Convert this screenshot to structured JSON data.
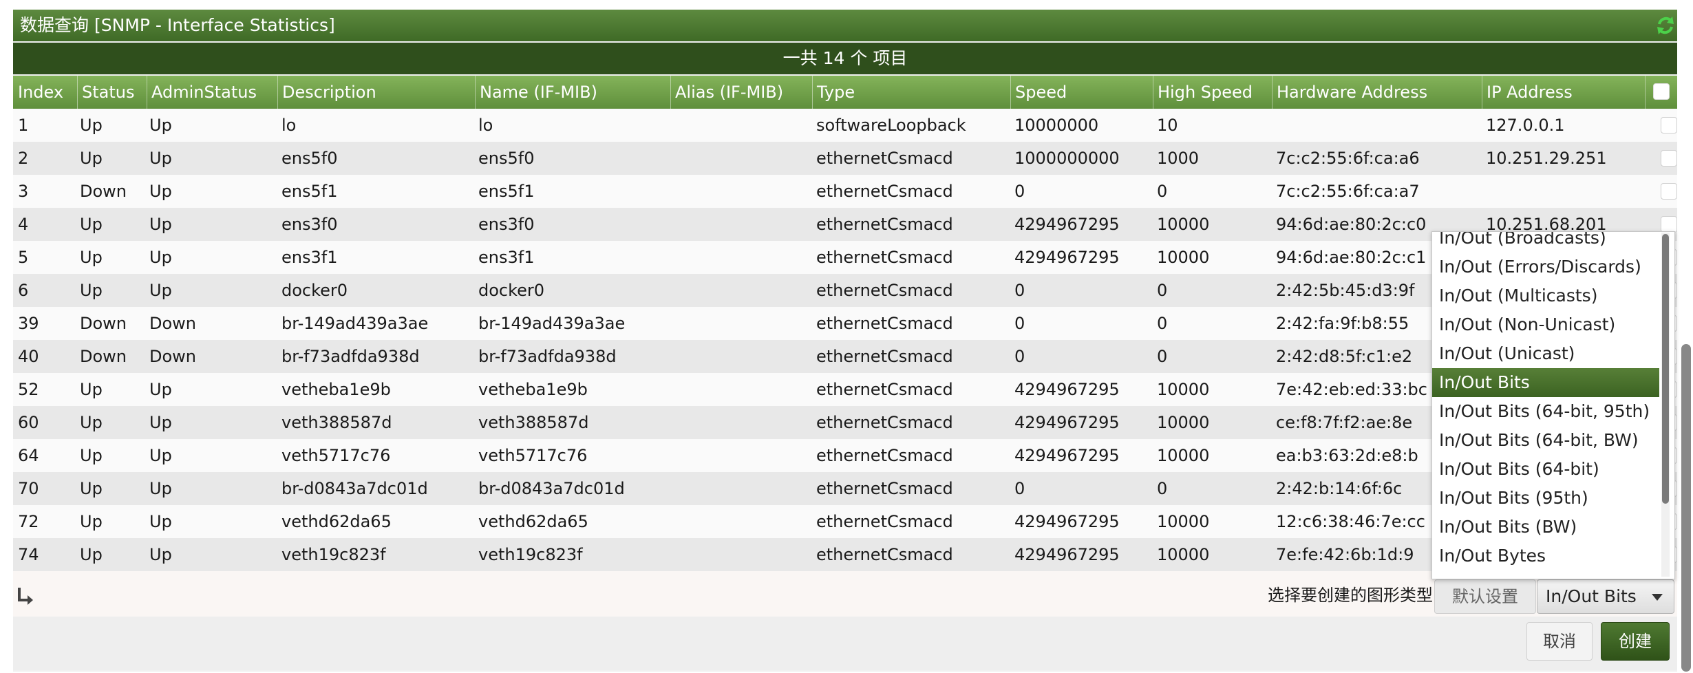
{
  "title": "数据查询 [SNMP - Interface Statistics]",
  "count_text": "一共 14 个 项目",
  "columns": [
    "Index",
    "Status",
    "AdminStatus",
    "Description",
    "Name (IF-MIB)",
    "Alias (IF-MIB)",
    "Type",
    "Speed",
    "High Speed",
    "Hardware Address",
    "IP Address"
  ],
  "rows": [
    [
      "1",
      "Up",
      "Up",
      "lo",
      "lo",
      "",
      "softwareLoopback",
      "10000000",
      "10",
      "",
      "127.0.0.1"
    ],
    [
      "2",
      "Up",
      "Up",
      "ens5f0",
      "ens5f0",
      "",
      "ethernetCsmacd",
      "1000000000",
      "1000",
      "7c:c2:55:6f:ca:a6",
      "10.251.29.251"
    ],
    [
      "3",
      "Down",
      "Up",
      "ens5f1",
      "ens5f1",
      "",
      "ethernetCsmacd",
      "0",
      "0",
      "7c:c2:55:6f:ca:a7",
      ""
    ],
    [
      "4",
      "Up",
      "Up",
      "ens3f0",
      "ens3f0",
      "",
      "ethernetCsmacd",
      "4294967295",
      "10000",
      "94:6d:ae:80:2c:c0",
      "10.251.68.201"
    ],
    [
      "5",
      "Up",
      "Up",
      "ens3f1",
      "ens3f1",
      "",
      "ethernetCsmacd",
      "4294967295",
      "10000",
      "94:6d:ae:80:2c:c1",
      ""
    ],
    [
      "6",
      "Up",
      "Up",
      "docker0",
      "docker0",
      "",
      "ethernetCsmacd",
      "0",
      "0",
      "2:42:5b:45:d3:9f",
      ""
    ],
    [
      "39",
      "Down",
      "Down",
      "br-149ad439a3ae",
      "br-149ad439a3ae",
      "",
      "ethernetCsmacd",
      "0",
      "0",
      "2:42:fa:9f:b8:55",
      ""
    ],
    [
      "40",
      "Down",
      "Down",
      "br-f73adfda938d",
      "br-f73adfda938d",
      "",
      "ethernetCsmacd",
      "0",
      "0",
      "2:42:d8:5f:c1:e2",
      ""
    ],
    [
      "52",
      "Up",
      "Up",
      "vetheba1e9b",
      "vetheba1e9b",
      "",
      "ethernetCsmacd",
      "4294967295",
      "10000",
      "7e:42:eb:ed:33:bc",
      ""
    ],
    [
      "60",
      "Up",
      "Up",
      "veth388587d",
      "veth388587d",
      "",
      "ethernetCsmacd",
      "4294967295",
      "10000",
      "ce:f8:7f:f2:ae:8e",
      ""
    ],
    [
      "64",
      "Up",
      "Up",
      "veth5717c76",
      "veth5717c76",
      "",
      "ethernetCsmacd",
      "4294967295",
      "10000",
      "ea:b3:63:2d:e8:b",
      ""
    ],
    [
      "70",
      "Up",
      "Up",
      "br-d0843a7dc01d",
      "br-d0843a7dc01d",
      "",
      "ethernetCsmacd",
      "0",
      "0",
      "2:42:b:14:6f:6c",
      ""
    ],
    [
      "72",
      "Up",
      "Up",
      "vethd62da65",
      "vethd62da65",
      "",
      "ethernetCsmacd",
      "4294967295",
      "10000",
      "12:c6:38:46:7e:cc",
      ""
    ],
    [
      "74",
      "Up",
      "Up",
      "veth19c823f",
      "veth19c823f",
      "",
      "ethernetCsmacd",
      "4294967295",
      "10000",
      "7e:fe:42:6b:1d:9",
      ""
    ]
  ],
  "footer": {
    "select_label": "选择要创建的图形类型",
    "default_button": "默认设置",
    "selected_graph": "In/Out Bits",
    "cancel_button": "取消",
    "create_button": "创建"
  },
  "dropdown_options": [
    "In/Out (Broadcasts)",
    "In/Out (Errors/Discards)",
    "In/Out (Multicasts)",
    "In/Out (Non-Unicast)",
    "In/Out (Unicast)",
    "In/Out Bits",
    "In/Out Bits (64-bit, 95th)",
    "In/Out Bits (64-bit, BW)",
    "In/Out Bits (64-bit)",
    "In/Out Bits (95th)",
    "In/Out Bits (BW)",
    "In/Out Bytes"
  ],
  "dropdown_selected_index": 5,
  "colors": {
    "title_green": "#4a7530",
    "count_bar": "#2f4f1c",
    "header_green": "#6f9f48",
    "create_button": "#3c6322"
  },
  "icons": {
    "refresh": "refresh-icon",
    "footer_arrow": "corner-arrow-icon"
  }
}
